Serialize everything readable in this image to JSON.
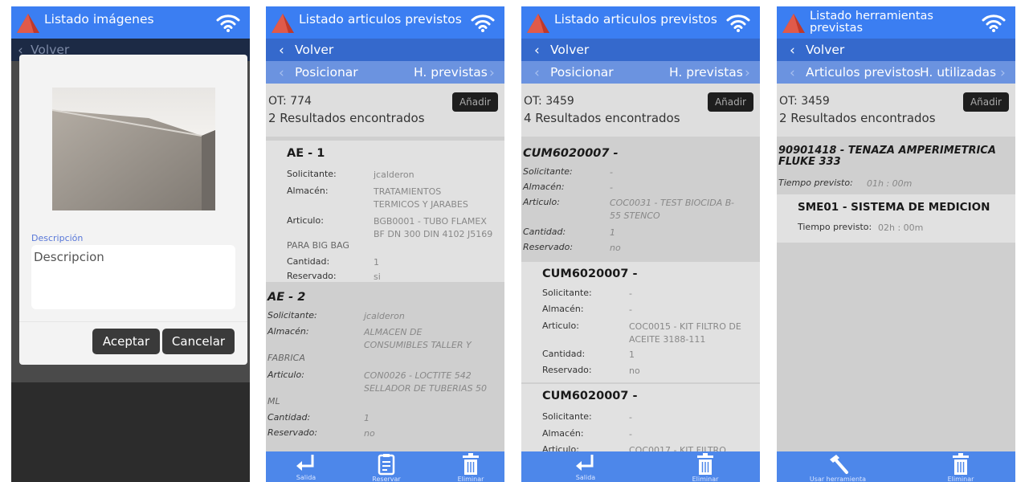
{
  "screens": [
    {
      "header_title": "Listado imágenes",
      "back_label": "Volver",
      "dialog": {
        "description_label": "Descripción",
        "description_placeholder": "Descripcion",
        "accept_label": "Aceptar",
        "cancel_label": "Cancelar"
      }
    },
    {
      "header_title": "Listado articulos previstos",
      "back_label": "Volver",
      "nav_left": "Posicionar",
      "nav_right": "H. previstas",
      "ot": "OT: 774",
      "results": "2 Resultados encontrados",
      "add_label": "Añadir",
      "cards": [
        {
          "title": "AE - 1",
          "rows": [
            {
              "key": "Solicitante:",
              "value": "jcalderon"
            },
            {
              "key": "Almacén:",
              "value": "TRATAMIENTOS\nTERMICOS Y JARABES"
            },
            {
              "key": "Articulo:",
              "value": "BGB0001 - TUBO FLAMEX\nBF DN 300 DIN 4102 J5169"
            },
            {
              "key": "PARA BIG BAG",
              "value": ""
            },
            {
              "key": "Cantidad:",
              "value": "1"
            },
            {
              "key": "Reservado:",
              "value": "si"
            }
          ]
        },
        {
          "title": "AE - 2",
          "rows": [
            {
              "key": "Solicitante:",
              "value": "jcalderon"
            },
            {
              "key": "Almacén:",
              "value": "ALMACEN DE\nCONSUMIBLES TALLER Y"
            },
            {
              "key": "FABRICA",
              "value": ""
            },
            {
              "key": "Articulo:",
              "value": "CON0026 - LOCTITE 542\nSELLADOR DE TUBERIAS 50"
            },
            {
              "key": "ML",
              "value": ""
            },
            {
              "key": "Cantidad:",
              "value": "1"
            },
            {
              "key": "Reservado:",
              "value": "no"
            }
          ]
        }
      ],
      "bottom_actions": [
        "Salida",
        "Reservar",
        "Eliminar"
      ]
    },
    {
      "header_title": "Listado articulos previstos",
      "back_label": "Volver",
      "nav_left": "Posicionar",
      "nav_right": "H. previstas",
      "ot": "OT: 3459",
      "results": "4 Resultados encontrados",
      "add_label": "Añadir",
      "cards": [
        {
          "title": "CUM6020007 -",
          "rows": [
            {
              "key": "Solicitante:",
              "value": "-"
            },
            {
              "key": "Almacén:",
              "value": "-"
            },
            {
              "key": "Articulo:",
              "value": "COC0031 - TEST BIOCIDA B-\n55 STENCO"
            },
            {
              "key": "Cantidad:",
              "value": "1"
            },
            {
              "key": "Reservado:",
              "value": "no"
            }
          ]
        },
        {
          "title": "CUM6020007 -",
          "rows": [
            {
              "key": "Solicitante:",
              "value": "-"
            },
            {
              "key": "Almacén:",
              "value": "-"
            },
            {
              "key": "Articulo:",
              "value": "COC0015 - KIT FILTRO DE\nACEITE 3188-111"
            },
            {
              "key": "Cantidad:",
              "value": "1"
            },
            {
              "key": "Reservado:",
              "value": "no"
            }
          ]
        },
        {
          "title": "CUM6020007 -",
          "rows": [
            {
              "key": "Solicitante:",
              "value": "-"
            },
            {
              "key": "Almacén:",
              "value": "-"
            },
            {
              "key": "Articulo:",
              "value": "COC0017 - KIT FILTRO"
            }
          ]
        }
      ],
      "bottom_actions": [
        "Salida",
        "Eliminar"
      ]
    },
    {
      "header_title": "Listado herramientas\nprevistas",
      "back_label": "Volver",
      "nav_left": "Articulos previstos",
      "nav_right": "H. utilizadas",
      "ot": "OT: 3459",
      "results": "2 Resultados encontrados",
      "add_label": "Añadir",
      "cards": [
        {
          "title": "90901418 - TENAZA AMPERIMETRICA\nFLUKE 333",
          "rows": [
            {
              "key": "Tiempo previsto:",
              "value": "01h : 00m"
            }
          ]
        },
        {
          "title": "SME01 - SISTEMA DE MEDICION",
          "rows": [
            {
              "key": "Tiempo previsto:",
              "value": "02h : 00m"
            }
          ]
        }
      ],
      "bottom_actions": [
        "Usar herramienta",
        "Eliminar"
      ]
    }
  ],
  "colors": {
    "header": "#3b7ef2",
    "back_bar": "#3569cc",
    "nav_bar": "#6b93e0",
    "bottom_bar": "#4d87ea",
    "add_button": "#1e1e1e",
    "dialog_button": "#3a3a3a"
  },
  "icons": {
    "logo": "red-triangle-logo-icon",
    "wifi": "wifi-icon",
    "back": "chevron-left-icon",
    "next": "chevron-right-icon",
    "exit": "return-arrow-icon",
    "reserve": "clipboard-icon",
    "delete": "trash-icon",
    "use_tool": "hammer-icon"
  }
}
